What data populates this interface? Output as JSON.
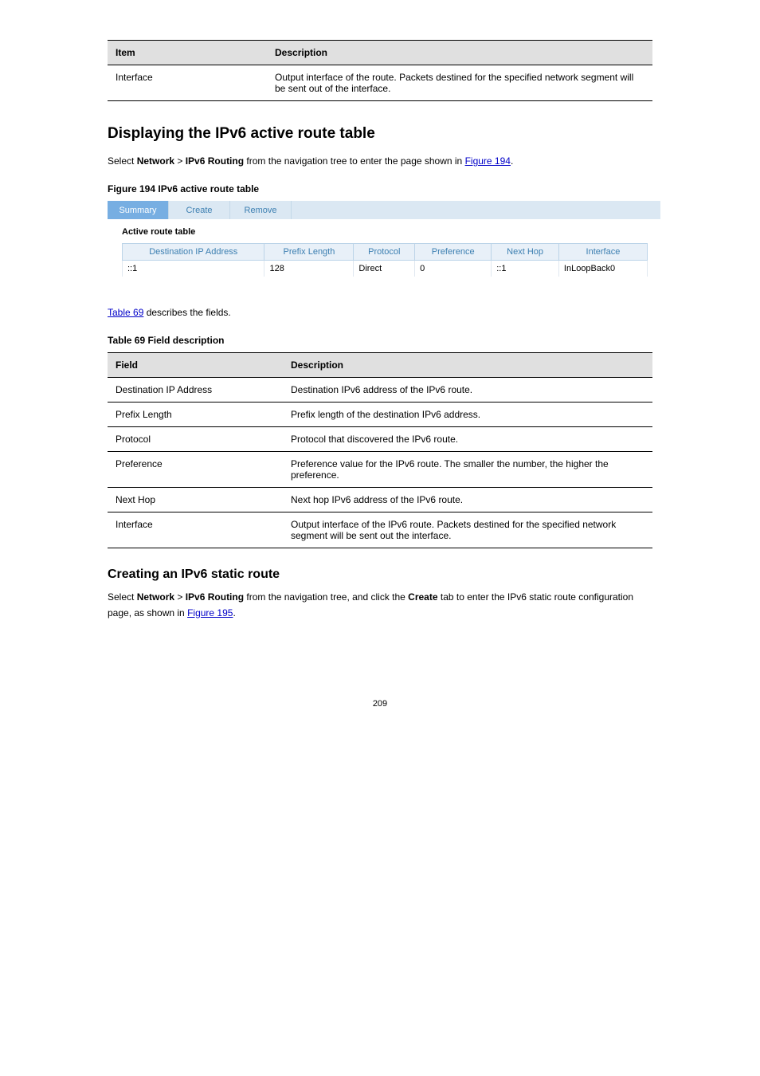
{
  "tables": {
    "t1": {
      "headers": [
        "Item",
        "Description"
      ],
      "rows": [
        [
          "Interface",
          "Output interface of the route. Packets destined for the specified network segment will be sent out of the interface."
        ]
      ]
    },
    "t2": {
      "caption": "Table 69 Field description",
      "headers": [
        "Field",
        "Description"
      ],
      "rows": [
        [
          "Destination IP Address",
          "Destination IPv6 address of the IPv6 route."
        ],
        [
          "Prefix Length",
          "Prefix length of the destination IPv6 address."
        ],
        [
          "Protocol",
          "Protocol that discovered the IPv6 route."
        ],
        [
          "Preference",
          "Preference value for the IPv6 route. The smaller the number, the higher the preference."
        ],
        [
          "Next Hop",
          "Next hop IPv6 address of the IPv6 route."
        ],
        [
          "Interface",
          "Output interface of the IPv6 route. Packets destined for the specified network segment will be sent out the interface."
        ]
      ]
    }
  },
  "headings": {
    "h1a": "Displaying the IPv6 active route table",
    "h2a": "Creating an IPv6 static route"
  },
  "paras": {
    "p1a": "Select ",
    "p1b": "Network",
    "p1c": " > ",
    "p1d": "IPv6 Routing",
    "p1e": " from the navigation tree to enter the page shown in ",
    "p1link": "Figure 194",
    "p1f": ".",
    "p2a": "Select ",
    "p2b": "Network",
    "p2c": " > ",
    "p2d": "IPv6 Routing",
    "p2e": " from the navigation tree, and click the ",
    "p2f": "Create",
    "p2g": " tab to enter the IPv6 static route configuration page, as shown in ",
    "p2link": "Figure 195",
    "p2h": ".",
    "t2_intro_a": " describes the fields.",
    "t2_intro_link": "Table 69"
  },
  "figure": {
    "caption": "Figure 194 IPv6 active route table",
    "tabs": [
      "Summary",
      "Create",
      "Remove"
    ],
    "subhead": "Active route table",
    "headers": [
      "Destination IP Address",
      "Prefix Length",
      "Protocol",
      "Preference",
      "Next Hop",
      "Interface"
    ],
    "row": [
      "::1",
      "128",
      "Direct",
      "0",
      "::1",
      "InLoopBack0"
    ]
  },
  "pagenum": "209"
}
